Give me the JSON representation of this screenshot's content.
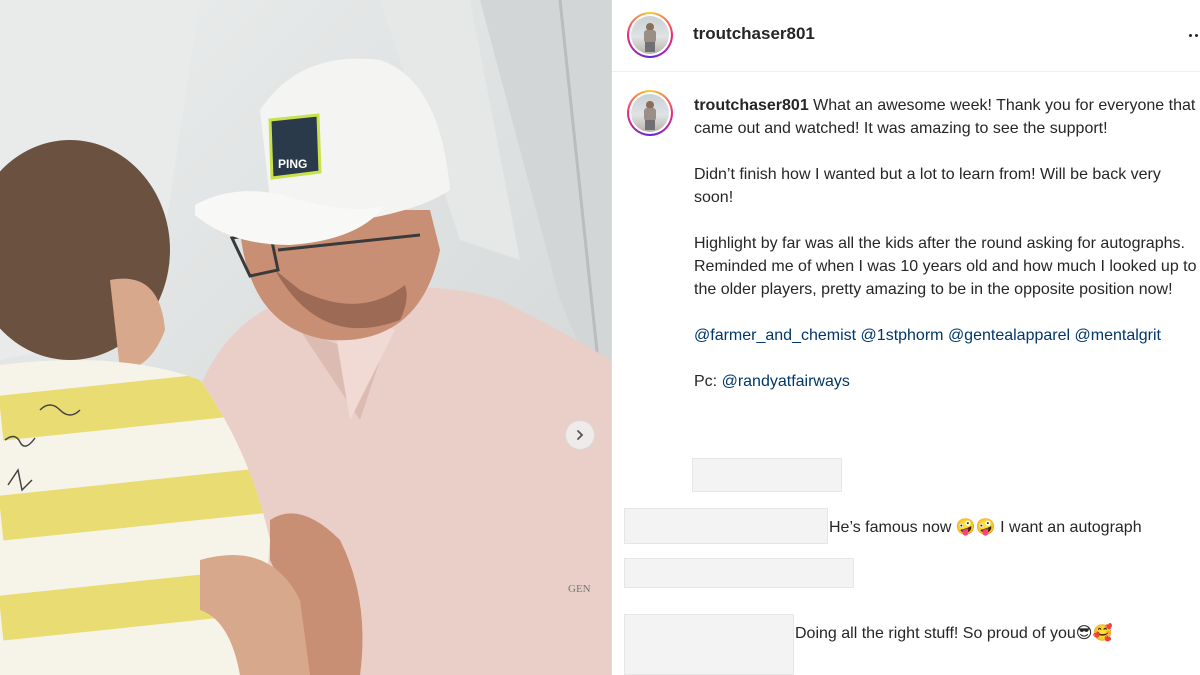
{
  "post": {
    "username": "troutchaser801",
    "photo_alt": "Golfer in white PING cap signing a child's shirt",
    "cap_logo_text": "PING",
    "shirt_logo_text": "GEN"
  },
  "caption": {
    "username": "troutchaser801",
    "p1": "What an awesome week! Thank you for everyone that came out and watched! It was amazing to see the support!",
    "p2": "Didn’t finish how I wanted but a lot to learn from! Will be back very soon!",
    "p3": "Highlight by far was all the kids after the round asking for autographs. Reminded me of when I was 10 years old and how much I looked up to the older players, pretty amazing to be in the opposite position now!",
    "mentions": [
      "@farmer_and_chemist",
      "@1stphorm",
      "@gentealapparel",
      "@mentalgrit"
    ],
    "photo_credit_label": "Pc:",
    "photo_credit_mention": "@randyatfairways"
  },
  "comments": [
    {
      "text": "He’s famous now 🤪🤪 I want an autograph"
    },
    {
      "text": "Doing all the right stuff! So proud of you😎🥰"
    }
  ],
  "icons": {
    "more": "more-options-icon",
    "carousel_next": "chevron-right-icon"
  },
  "colors": {
    "mention": "#00376b",
    "text": "#262626",
    "border": "#dbdbdb"
  }
}
